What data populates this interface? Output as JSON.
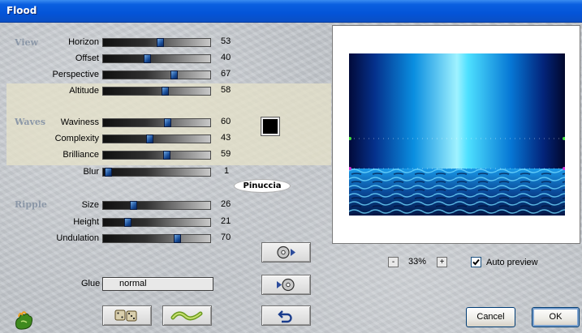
{
  "window": {
    "title": "Flood"
  },
  "sections": {
    "view": "View",
    "waves": "Waves",
    "ripple": "Ripple"
  },
  "view": [
    {
      "label": "Horizon",
      "value": "53"
    },
    {
      "label": "Offset",
      "value": "40"
    },
    {
      "label": "Perspective",
      "value": "67"
    },
    {
      "label": "Altitude",
      "value": "58"
    }
  ],
  "waves": [
    {
      "label": "Waviness",
      "value": "60"
    },
    {
      "label": "Complexity",
      "value": "43"
    },
    {
      "label": "Brilliance",
      "value": "59"
    },
    {
      "label": "Blur",
      "value": "1"
    }
  ],
  "ripple": [
    {
      "label": "Size",
      "value": "26"
    },
    {
      "label": "Height",
      "value": "21"
    },
    {
      "label": "Undulation",
      "value": "70"
    }
  ],
  "wave_color": "#000000",
  "watermark": "Pinuccia",
  "glue": {
    "label": "Glue",
    "value": "normal"
  },
  "preview": {
    "zoom": "33%",
    "zoom_out": "-",
    "zoom_in": "+",
    "auto_preview_label": "Auto preview",
    "auto_preview_checked": true
  },
  "buttons": {
    "cancel": "Cancel",
    "ok": "OK"
  },
  "icons": {
    "app_logo": "flaming-hand-icon",
    "random": "dice-icon",
    "wave": "wave-icon",
    "save_preset": "save-disc-icon",
    "load_preset": "load-disc-icon",
    "reset": "undo-arrow-icon"
  }
}
